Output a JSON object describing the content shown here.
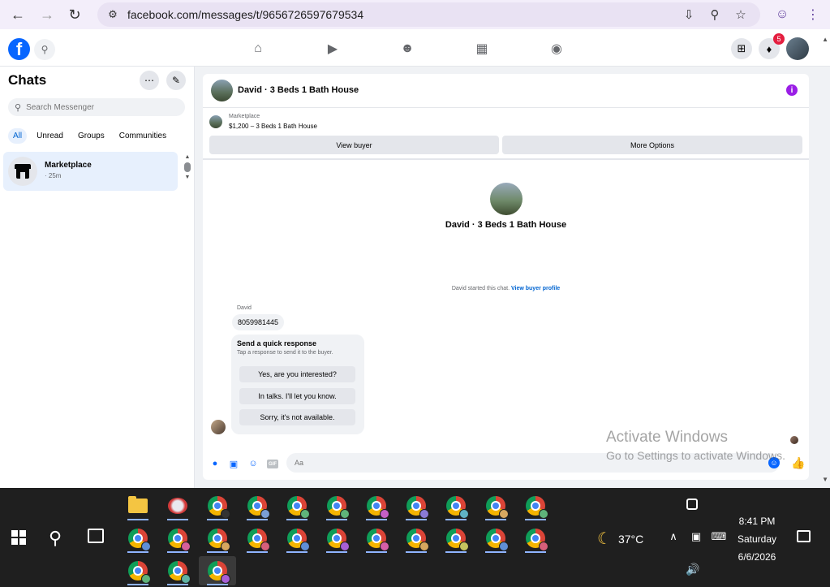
{
  "browser": {
    "url": "facebook.com/messages/t/9656726597679534"
  },
  "fb_header": {
    "logo": "f",
    "notification_count": "5"
  },
  "sidebar": {
    "title": "Chats",
    "search_placeholder": "Search Messenger",
    "filters": [
      "All",
      "Unread",
      "Groups",
      "Communities"
    ],
    "active_filter": "All",
    "chats": [
      {
        "name": "Marketplace",
        "time": "· 25m",
        "icon": "store-icon"
      }
    ]
  },
  "chat": {
    "header_title": "David · 3 Beds 1 Bath House",
    "listing": {
      "source": "Marketplace",
      "price_title": "$1,200 – 3 Beds 1 Bath House",
      "view_buyer": "View buyer",
      "more_options": "More Options"
    },
    "profile_name": "David · 3 Beds 1 Bath House",
    "started_text": "David started this chat.",
    "view_buyer_profile": "View buyer profile",
    "sender": "David",
    "message": "8059981445",
    "quick_response": {
      "title": "Send a quick response",
      "subtitle": "Tap a response to send it to the buyer.",
      "options": [
        "Yes, are you interested?",
        "In talks. I'll let you know.",
        "Sorry, it's not available."
      ]
    },
    "composer_placeholder": "Aa",
    "gif_label": "GIF"
  },
  "watermark": {
    "line1": "Activate Windows",
    "line2": "Go to Settings to activate Windows."
  },
  "taskbar": {
    "temperature": "37°C",
    "time": "8:41 PM",
    "day": "Saturday",
    "date": "6/6/2026"
  },
  "colors": {
    "fb_blue": "#0866ff",
    "active_chat_bg": "#e7f0fd",
    "info_purple": "#9a1ee6",
    "taskbar_bg": "#1f1f1f"
  }
}
